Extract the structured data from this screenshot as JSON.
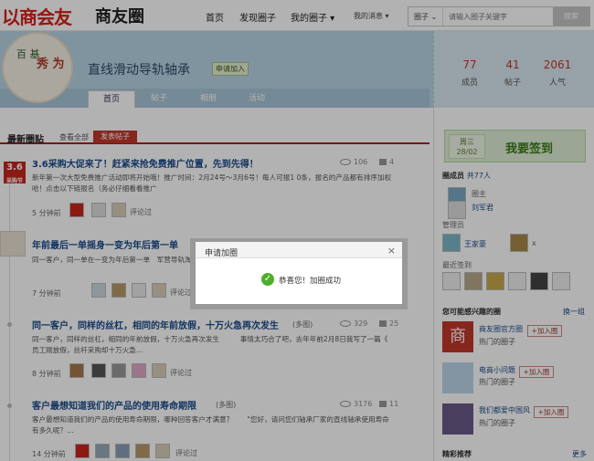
{
  "header": {
    "logo_text": "以商会友",
    "logo_sub": "商友圈",
    "nav": [
      "首页",
      "发现圈子",
      "我的圈子 ▾"
    ],
    "messages": "我的消息 ▾",
    "search_scope": "圈子 ⌄",
    "search_placeholder": "请输入圈子关键字",
    "search_button": "搜索"
  },
  "group": {
    "avatar_text_1": "百 基",
    "avatar_text_2": "秀 为",
    "name": "直线滑动导轨轴承",
    "join_label": "申请加入",
    "tabs": [
      "首页",
      "帖子",
      "相册",
      "活动"
    ],
    "stats": [
      {
        "value": "77",
        "label": "成员"
      },
      {
        "value": "41",
        "label": "帖子"
      },
      {
        "value": "2061",
        "label": "人气"
      }
    ]
  },
  "posts_header": {
    "title": "最新圈贴",
    "view_all": "查看全部",
    "new_post": "发表帖子"
  },
  "threads": [
    {
      "title": "3.6采购大促来了！赶紧来抢免费推广位置，先到先得！",
      "views": "106",
      "replies": "4",
      "desc": "新年第一次大型免费推广活动即将开始哦！推广时间：2月24号～3月6号！每人可报1 0条，报名的产品都有排序加权哈！点击以下链报名（务必仔细看看推广",
      "time": "5 分钟前",
      "badge": "3.6\n采购节",
      "comment": "评论过"
    },
    {
      "title": "年前最后一单摇身一变为年后第一单",
      "views": "",
      "replies": "",
      "desc": "同一客户，同一单在一变为年后第一单　军营导轨淘宝店铺… 的程经理会看要正宗新疆三益SAMICK直线轴承LM…",
      "time": "7 分钟前",
      "badge": "",
      "comment": "评论过"
    },
    {
      "title": "同一客户，同样的丝杠，相同的年前放假，十万火急再次发生",
      "views": "329",
      "replies": "25",
      "tag": "(多图)",
      "desc": "同一客户，同样的丝杠，相同的年前放假，十万火急再次发生　　　事情太巧合了吧，去年年前2月8日我写了一篇《 员工刚放假，丝杆采购却十万火急…",
      "time": "8 分钟前",
      "badge": "",
      "comment": "评论过"
    },
    {
      "title": "客户最想知道我们的产品的使用寿命期限",
      "views": "3176",
      "replies": "11",
      "tag": "(多图)",
      "desc": "客户最想知道我们的产品的使用寿命期限，哪种回答客户才满意？　　\"您好，请问您们轴承厂家的直线轴承使用寿命有多久呢？…",
      "time": "14 分钟前",
      "badge": "",
      "comment": "评论过"
    }
  ],
  "right": {
    "checkin_weekday": "周三",
    "checkin_date": "28/02",
    "checkin_label": "我要签到",
    "members_title": "圈成员",
    "members_count": "共77人",
    "owner_role": "圈主",
    "owner_name": "刘军君",
    "admin_title": "管理员",
    "admin_name": "王家豪",
    "admin_x": "x",
    "recent_title": "最近签到",
    "recommend_title": "您可能感兴趣的圈",
    "recommend_switch": "换一组",
    "recommend": [
      {
        "name": "商友圈官方圈",
        "sub": "热门的圈子",
        "btn": "+加入圈"
      },
      {
        "name": "电商小问题",
        "sub": "热门的圈子",
        "btn": "+加入圈"
      },
      {
        "name": "我们都爱中国风",
        "sub": "热门的圈子",
        "btn": "+加入圈"
      }
    ],
    "featured_title": "精彩推荐",
    "featured_more": "更多"
  },
  "dialog": {
    "title": "申请加圈",
    "close": "×",
    "message": "恭喜您！加圈成功"
  },
  "colors": {
    "accent_red": "#c0392b",
    "link_blue": "#1a4a8a",
    "banner": "#b8d4e4",
    "success": "#4caf2b"
  }
}
